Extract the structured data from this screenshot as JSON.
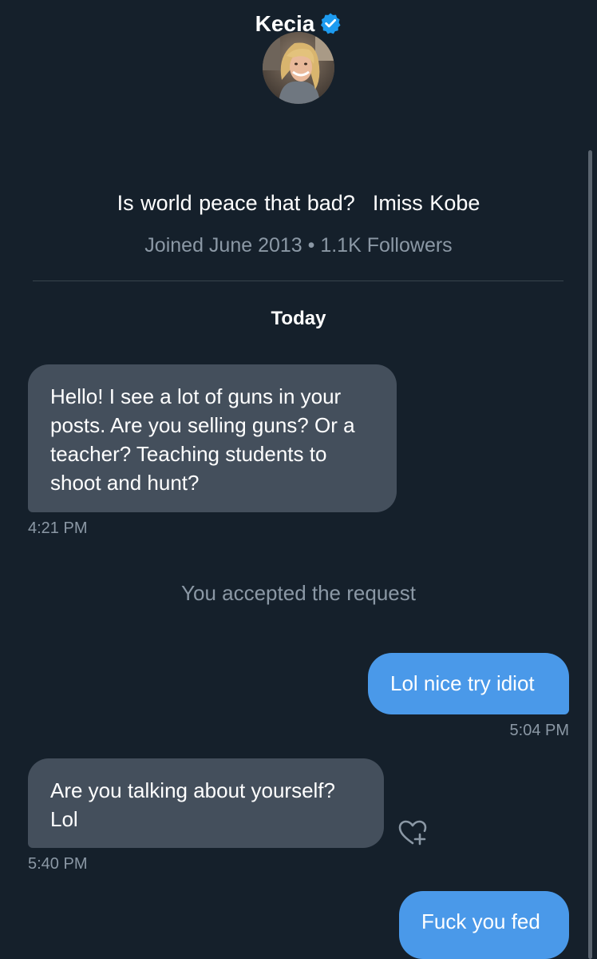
{
  "header": {
    "name": "Kecia",
    "verified_color": "#1d9bf0"
  },
  "profile": {
    "bio_part1": "Is world peace that bad?",
    "bio_part2": "Imiss Kobe",
    "joined": "Joined June 2013 • 1.1K Followers"
  },
  "conversation": {
    "day_label": "Today",
    "system_message": "You accepted the request",
    "messages": [
      {
        "direction": "incoming",
        "text": "Hello! I see a lot of guns in your posts. Are you selling guns? Or a teacher? Teaching students to shoot and hunt?",
        "time": "4:21 PM"
      },
      {
        "direction": "outgoing",
        "text": "Lol nice try idiot",
        "time": "5:04 PM"
      },
      {
        "direction": "incoming",
        "text": "Are you talking about yourself? Lol",
        "time": "5:40 PM"
      },
      {
        "direction": "outgoing",
        "text": "Fuck you fed",
        "time": ""
      }
    ]
  },
  "icons": {
    "verified": "verified-badge-icon",
    "react": "heart-plus-icon"
  },
  "colors": {
    "background": "#15202b",
    "incoming_bubble": "#444f5c",
    "outgoing_bubble": "#4a99e9",
    "muted_text": "#8b98a5"
  }
}
